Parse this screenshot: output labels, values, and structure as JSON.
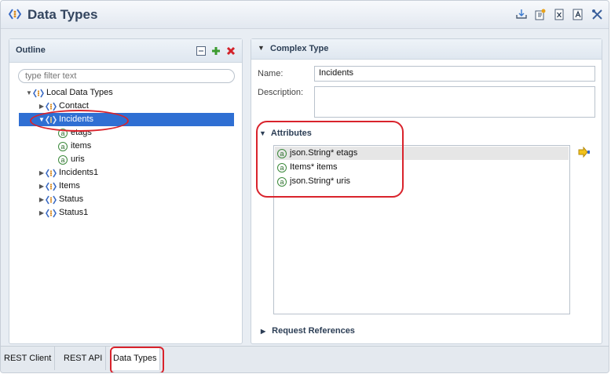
{
  "window": {
    "title": "Data Types"
  },
  "toolbar": {
    "icons": [
      "import-icon",
      "export-icon",
      "clear-icon",
      "validate-icon",
      "tools-icon"
    ]
  },
  "outline": {
    "title": "Outline",
    "filter_placeholder": "type filter text",
    "tree": {
      "root_label": "Local Data Types",
      "items": [
        {
          "label": "Contact"
        },
        {
          "label": "Incidents",
          "selected": true,
          "children": [
            "etags",
            "items",
            "uris"
          ]
        },
        {
          "label": "Incidents1"
        },
        {
          "label": "Items"
        },
        {
          "label": "Status"
        },
        {
          "label": "Status1"
        }
      ]
    }
  },
  "complex_type": {
    "section_title": "Complex Type",
    "name_label": "Name:",
    "name_value": "Incidents",
    "description_label": "Description:",
    "description_value": "",
    "attributes_title": "Attributes",
    "attributes": [
      "json.String* etags",
      "Items* items",
      "json.String* uris"
    ],
    "request_references_title": "Request References"
  },
  "tabs": [
    "REST Client",
    "REST API",
    "Data Types"
  ],
  "colors": {
    "accent": "#2f6fd3",
    "callout": "#d9232c",
    "title": "#33455f"
  }
}
